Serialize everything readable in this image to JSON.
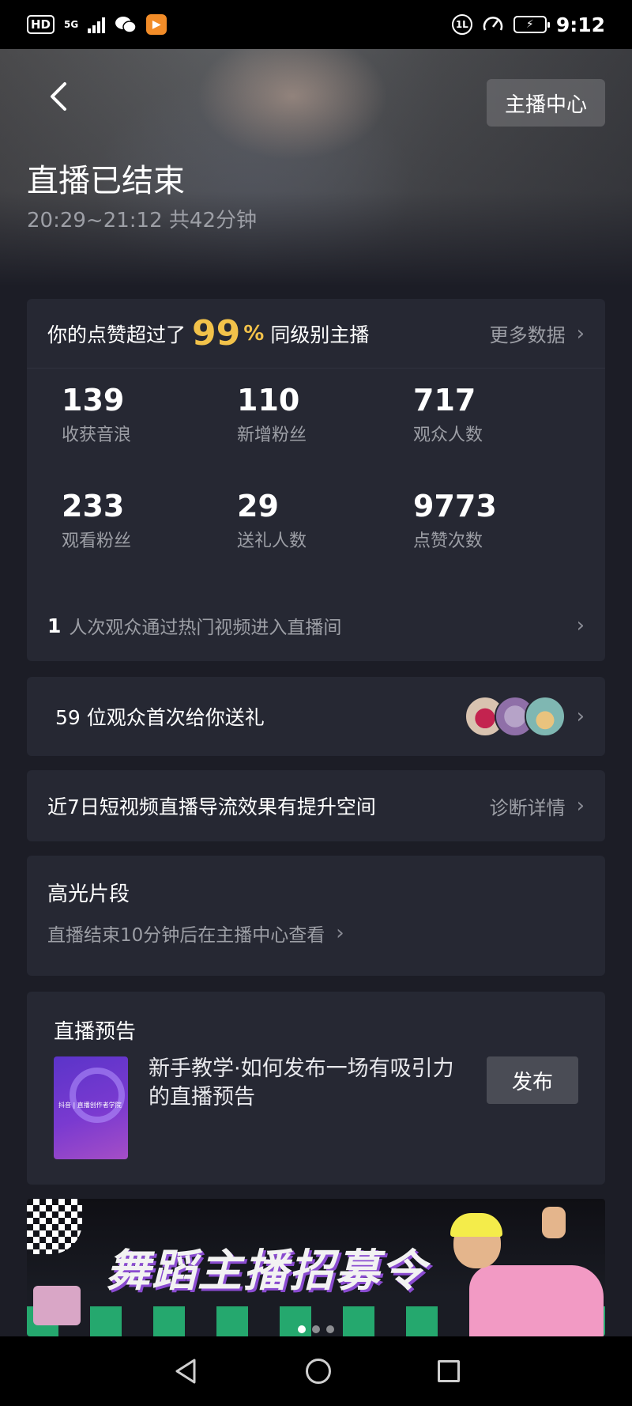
{
  "status_bar": {
    "hd_label": "HD",
    "network": "5G",
    "time": "9:12",
    "data_saver_label": "1L"
  },
  "header": {
    "back_icon": "chevron-left-icon",
    "anchor_center_label": "主播中心",
    "title": "直播已结束",
    "time_range": "20:29~21:12 共42分钟"
  },
  "stats": {
    "like_prefix": "你的点赞超过了",
    "like_percent": "99",
    "like_percent_sign": "%",
    "like_suffix": "同级别主播",
    "more_data_label": "更多数据",
    "items": [
      {
        "value": "139",
        "label": "收获音浪"
      },
      {
        "value": "110",
        "label": "新增粉丝"
      },
      {
        "value": "717",
        "label": "观众人数"
      },
      {
        "value": "233",
        "label": "观看粉丝"
      },
      {
        "value": "29",
        "label": "送礼人数"
      },
      {
        "value": "9773",
        "label": "点赞次数"
      }
    ],
    "hot_video_count": "1",
    "hot_video_text": "人次观众通过热门视频进入直播间"
  },
  "gift": {
    "text": "59 位观众首次给你送礼"
  },
  "diagnosis": {
    "text": "近7日短视频直播导流效果有提升空间",
    "link_label": "诊断详情"
  },
  "highlights": {
    "title": "高光片段",
    "subtitle": "直播结束10分钟后在主播中心查看"
  },
  "preview": {
    "title": "直播预告",
    "thumb_caption": "抖音 | 直播创作者学院",
    "description": "新手教学·如何发布一场有吸引力的直播预告",
    "publish_label": "发布"
  },
  "banner": {
    "title": "舞蹈主播招募令"
  },
  "colors": {
    "accent": "#f2c24a",
    "card_bg": "#262833",
    "page_bg": "#1c1d26",
    "muted_text": "#9d9fa6"
  }
}
